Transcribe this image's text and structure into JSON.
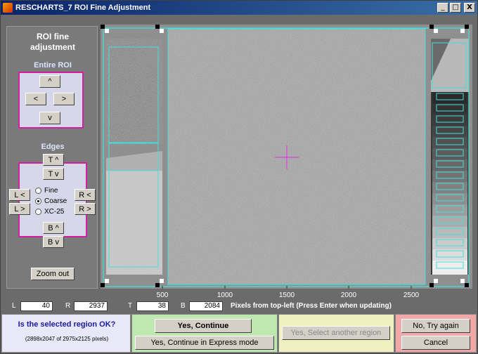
{
  "window": {
    "title": "RESCHARTS_7 ROI Fine Adjustment",
    "controls": [
      "_",
      "□",
      "X"
    ]
  },
  "left_panel": {
    "title_line1": "ROI fine",
    "title_line2": "adjustment",
    "entire_roi_label": "Entire ROI",
    "up": "^",
    "left": "<",
    "right": ">",
    "down": "v",
    "edges_label": "Edges",
    "top_up": "T ^",
    "top_down": "T v",
    "left_left": "L <",
    "left_right": "L >",
    "right_left": "R <",
    "right_right": "R >",
    "bottom_up": "B ^",
    "bottom_down": "B v",
    "step_options": [
      "Fine",
      "Coarse",
      "XC-25"
    ],
    "step_selected": "Coarse",
    "zoom_out": "Zoom out"
  },
  "image": {
    "x_ticks": [
      "500",
      "1000",
      "1500",
      "2000",
      "2500"
    ]
  },
  "coords": {
    "L_label": "L",
    "L_value": "40",
    "R_label": "R",
    "R_value": "2937",
    "T_label": "T",
    "T_value": "38",
    "B_label": "B",
    "B_value": "2084",
    "hint": "Pixels from top-left  (Press Enter when updating)"
  },
  "bottom": {
    "question": "Is the selected region OK?",
    "dims": "(2898x2047 of 2975x2125 pixels)",
    "yes_continue": "Yes, Continue",
    "yes_express": "Yes, Continue in Express mode",
    "yes_another": "Yes, Select another region",
    "no_try_again": "No, Try again",
    "cancel": "Cancel"
  },
  "colors": {
    "roi_outline": "#40e0e0",
    "crosshair": "#e040e0",
    "panel_border": "#d020a0"
  }
}
